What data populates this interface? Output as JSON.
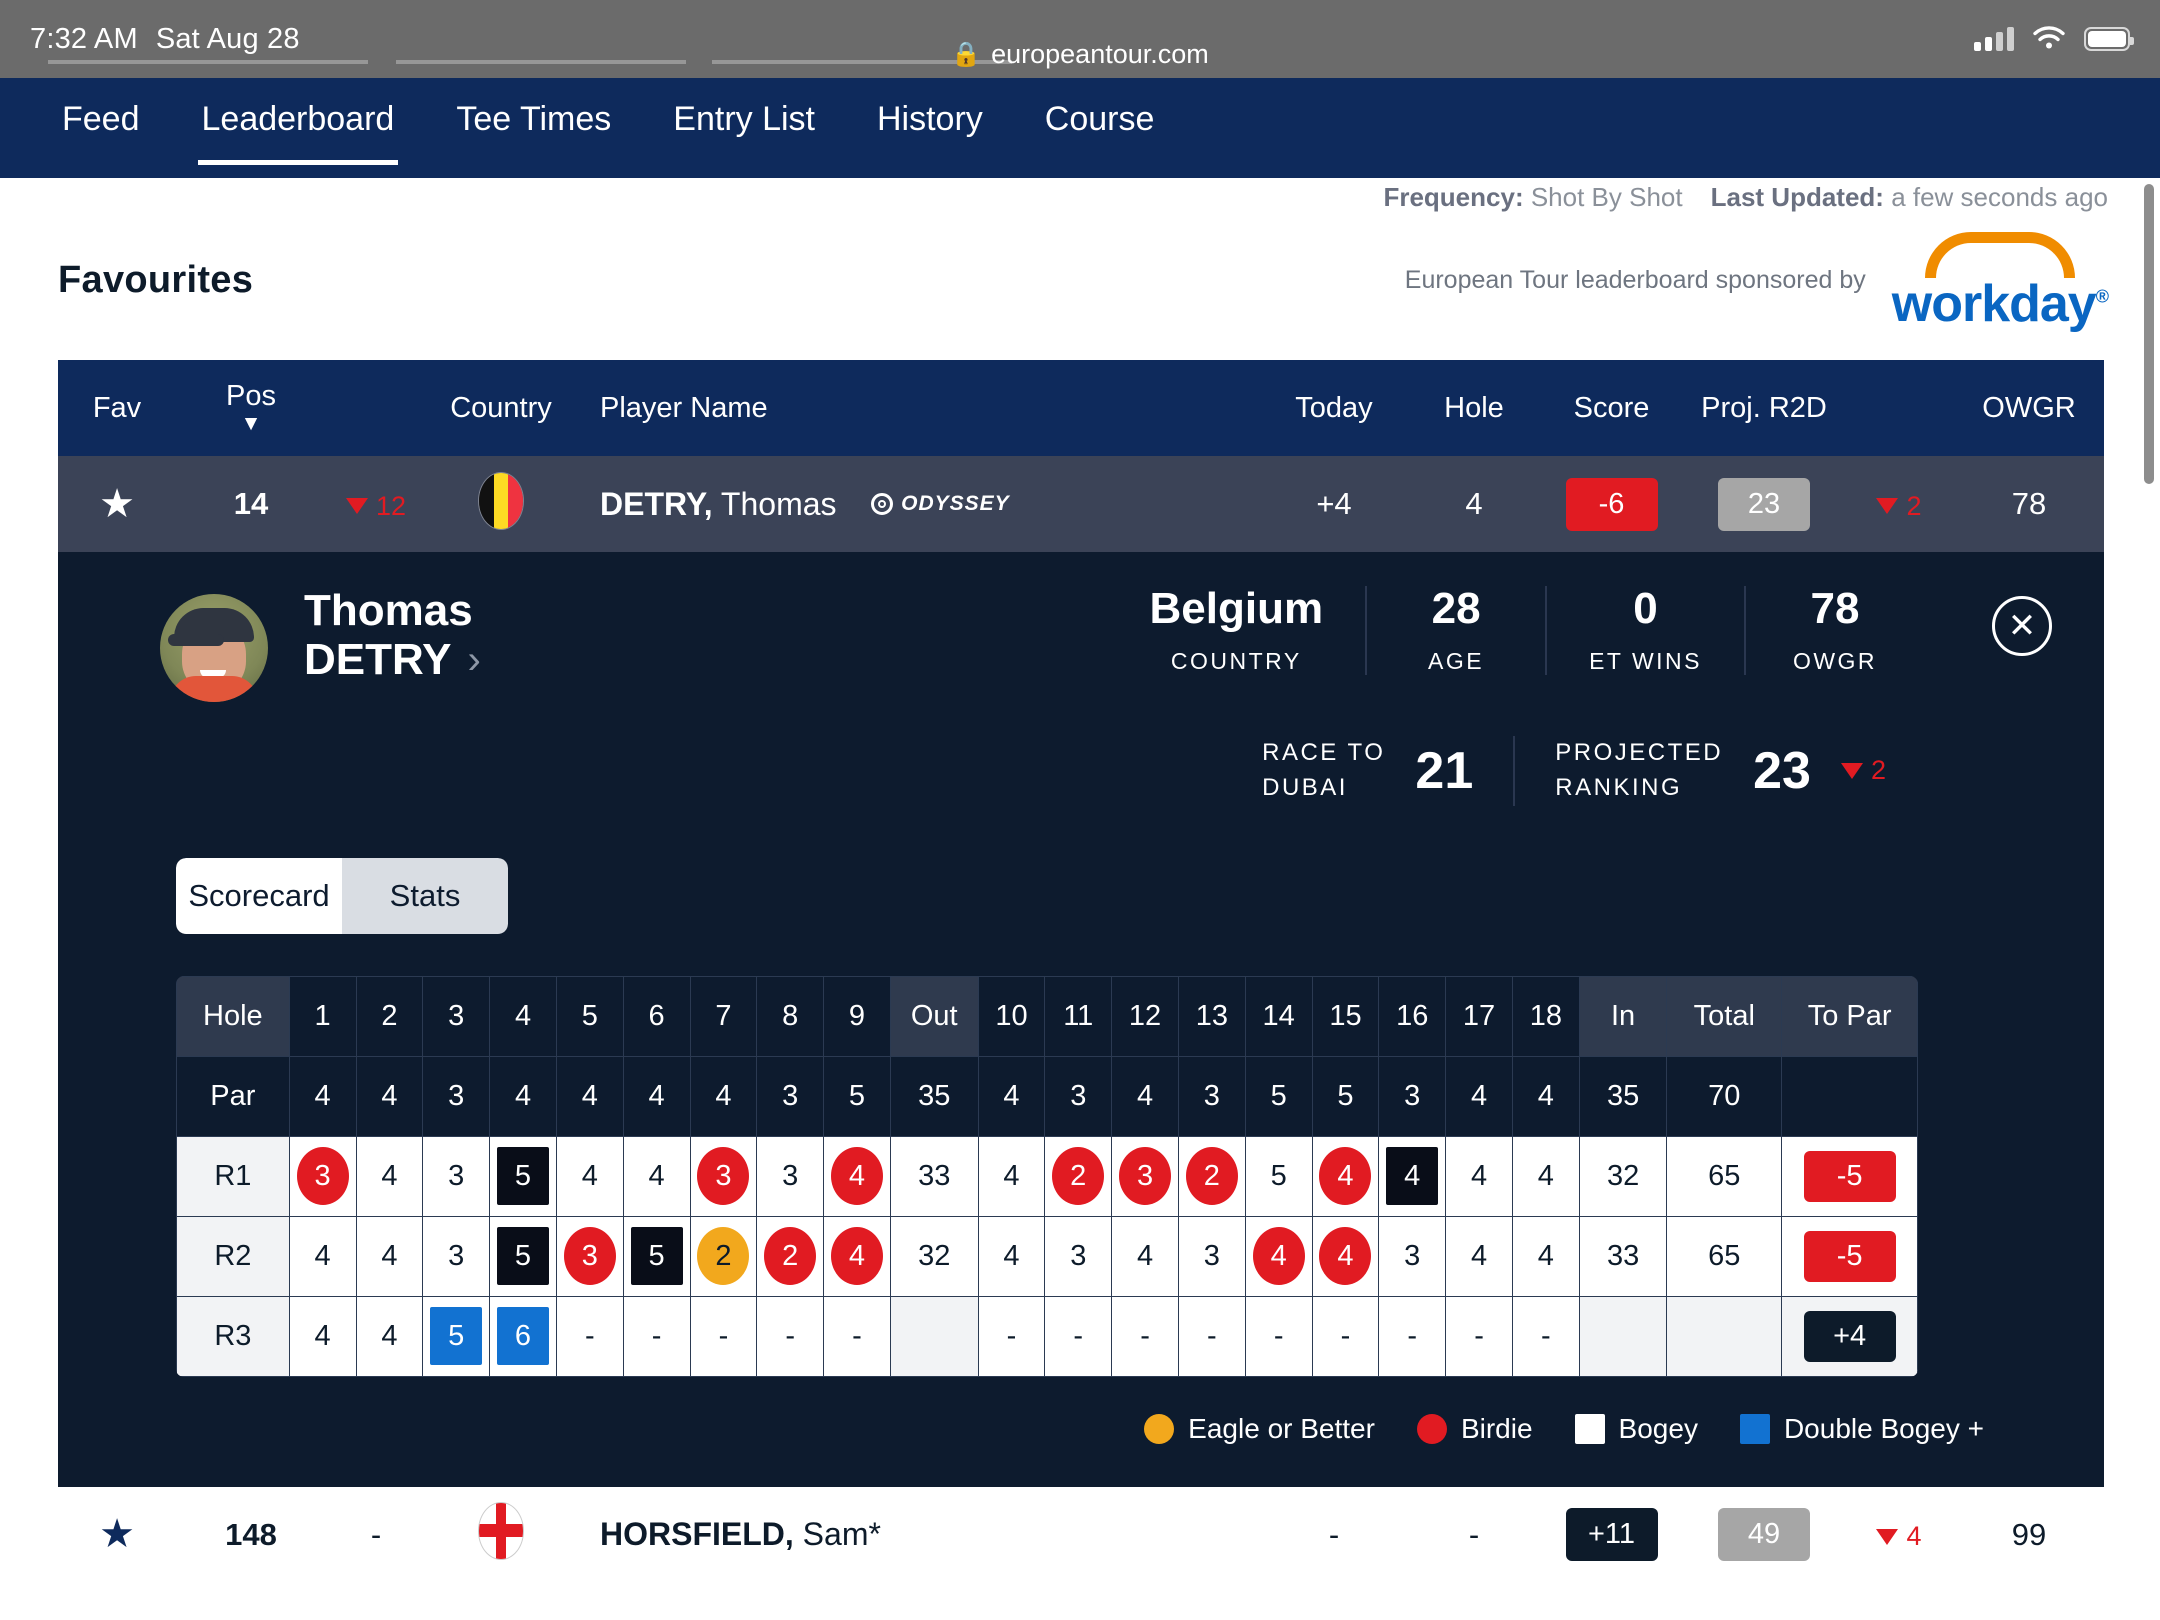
{
  "status_bar": {
    "time": "7:32 AM",
    "date": "Sat Aug 28"
  },
  "browser": {
    "url": "europeantour.com",
    "lock_icon": "lock-icon"
  },
  "nav": {
    "items": [
      {
        "label": "Feed",
        "active": false
      },
      {
        "label": "Leaderboard",
        "active": true
      },
      {
        "label": "Tee Times",
        "active": false
      },
      {
        "label": "Entry List",
        "active": false
      },
      {
        "label": "History",
        "active": false
      },
      {
        "label": "Course",
        "active": false
      }
    ]
  },
  "meta": {
    "frequency_label": "Frequency:",
    "frequency_value": "Shot By Shot",
    "updated_label": "Last Updated:",
    "updated_value": "a few seconds ago"
  },
  "section": {
    "title": "Favourites",
    "sponsor_text": "European Tour leaderboard sponsored by",
    "sponsor_name": "workday"
  },
  "table": {
    "headers": {
      "fav": "Fav",
      "pos": "Pos",
      "country": "Country",
      "player": "Player Name",
      "today": "Today",
      "hole": "Hole",
      "score": "Score",
      "proj": "Proj. R2D",
      "owgr": "OWGR"
    },
    "rows": [
      {
        "fav_icon": "star-filled-icon",
        "pos": "14",
        "move_dir": "down",
        "move_val": "12",
        "country_flag": "flag-belgium",
        "player_last": "DETRY,",
        "player_first": "Thomas",
        "sponsor_badge": "ODYSSEY",
        "today": "+4",
        "hole": "4",
        "score": "-6",
        "score_style": "red",
        "proj_r2d": "23",
        "proj_move_dir": "down",
        "proj_move_val": "2",
        "owgr": "78",
        "expanded": true
      },
      {
        "fav_icon": "star-filled-icon",
        "pos": "148",
        "move_dir": "none",
        "move_val": "-",
        "country_flag": "flag-england",
        "player_last": "HORSFIELD,",
        "player_first": "Sam*",
        "today": "-",
        "hole": "-",
        "score": "+11",
        "score_style": "navy",
        "proj_r2d": "49",
        "proj_move_dir": "down",
        "proj_move_val": "4",
        "owgr": "99",
        "expanded": false
      }
    ]
  },
  "detail": {
    "first_name": "Thomas",
    "last_name": "DETRY",
    "chevron": "›",
    "close_icon": "close-circle-icon",
    "stats": [
      {
        "value": "Belgium",
        "key": "COUNTRY"
      },
      {
        "value": "28",
        "key": "AGE"
      },
      {
        "value": "0",
        "key": "ET WINS"
      },
      {
        "value": "78",
        "key": "OWGR"
      }
    ],
    "rankings": [
      {
        "key_line1": "RACE TO",
        "key_line2": "DUBAI",
        "value": "21",
        "move_dir": "none",
        "move_val": ""
      },
      {
        "key_line1": "PROJECTED",
        "key_line2": "RANKING",
        "value": "23",
        "move_dir": "down",
        "move_val": "2"
      }
    ],
    "tabs": {
      "scorecard": "Scorecard",
      "stats": "Stats",
      "active": "Scorecard"
    }
  },
  "scorecard": {
    "row_labels": {
      "hole": "Hole",
      "par": "Par",
      "out": "Out",
      "in": "In",
      "total": "Total",
      "to_par": "To Par"
    },
    "holes": [
      "1",
      "2",
      "3",
      "4",
      "5",
      "6",
      "7",
      "8",
      "9"
    ],
    "holes_back": [
      "10",
      "11",
      "12",
      "13",
      "14",
      "15",
      "16",
      "17",
      "18"
    ],
    "par_front": [
      "4",
      "4",
      "3",
      "4",
      "4",
      "4",
      "4",
      "3",
      "5"
    ],
    "par_out": "35",
    "par_back": [
      "4",
      "3",
      "4",
      "3",
      "5",
      "5",
      "3",
      "4",
      "4"
    ],
    "par_in": "35",
    "par_total": "70",
    "rounds": [
      {
        "label": "R1",
        "front": [
          {
            "v": "3",
            "m": "birdie"
          },
          {
            "v": "4",
            "m": ""
          },
          {
            "v": "3",
            "m": ""
          },
          {
            "v": "5",
            "m": "bogey"
          },
          {
            "v": "4",
            "m": ""
          },
          {
            "v": "4",
            "m": ""
          },
          {
            "v": "3",
            "m": "birdie"
          },
          {
            "v": "3",
            "m": ""
          },
          {
            "v": "4",
            "m": "birdie"
          }
        ],
        "out": "33",
        "back": [
          {
            "v": "4",
            "m": ""
          },
          {
            "v": "2",
            "m": "birdie"
          },
          {
            "v": "3",
            "m": "birdie"
          },
          {
            "v": "2",
            "m": "birdie"
          },
          {
            "v": "5",
            "m": ""
          },
          {
            "v": "4",
            "m": "birdie"
          },
          {
            "v": "4",
            "m": "bogey"
          },
          {
            "v": "4",
            "m": ""
          },
          {
            "v": "4",
            "m": ""
          }
        ],
        "in": "32",
        "total": "65",
        "to_par": "-5",
        "to_par_style": "red"
      },
      {
        "label": "R2",
        "front": [
          {
            "v": "4",
            "m": ""
          },
          {
            "v": "4",
            "m": ""
          },
          {
            "v": "3",
            "m": ""
          },
          {
            "v": "5",
            "m": "bogey"
          },
          {
            "v": "3",
            "m": "birdie"
          },
          {
            "v": "5",
            "m": "bogey"
          },
          {
            "v": "2",
            "m": "eagle"
          },
          {
            "v": "2",
            "m": "birdie"
          },
          {
            "v": "4",
            "m": "birdie"
          }
        ],
        "out": "32",
        "back": [
          {
            "v": "4",
            "m": ""
          },
          {
            "v": "3",
            "m": ""
          },
          {
            "v": "4",
            "m": ""
          },
          {
            "v": "3",
            "m": ""
          },
          {
            "v": "4",
            "m": "birdie"
          },
          {
            "v": "4",
            "m": "birdie"
          },
          {
            "v": "3",
            "m": ""
          },
          {
            "v": "4",
            "m": ""
          },
          {
            "v": "4",
            "m": ""
          }
        ],
        "in": "33",
        "total": "65",
        "to_par": "-5",
        "to_par_style": "red"
      },
      {
        "label": "R3",
        "front": [
          {
            "v": "4",
            "m": ""
          },
          {
            "v": "4",
            "m": ""
          },
          {
            "v": "5",
            "m": "dbl"
          },
          {
            "v": "6",
            "m": "dbl"
          },
          {
            "v": "-",
            "m": ""
          },
          {
            "v": "-",
            "m": ""
          },
          {
            "v": "-",
            "m": ""
          },
          {
            "v": "-",
            "m": ""
          },
          {
            "v": "-",
            "m": ""
          }
        ],
        "out": "",
        "back": [
          {
            "v": "-",
            "m": ""
          },
          {
            "v": "-",
            "m": ""
          },
          {
            "v": "-",
            "m": ""
          },
          {
            "v": "-",
            "m": ""
          },
          {
            "v": "-",
            "m": ""
          },
          {
            "v": "-",
            "m": ""
          },
          {
            "v": "-",
            "m": ""
          },
          {
            "v": "-",
            "m": ""
          },
          {
            "v": "-",
            "m": ""
          }
        ],
        "in": "",
        "total": "",
        "to_par": "+4",
        "to_par_style": "navy"
      }
    ],
    "legend": [
      {
        "label": "Eagle or Better",
        "swatch": "c-eagle"
      },
      {
        "label": "Birdie",
        "swatch": "c-birdie"
      },
      {
        "label": "Bogey",
        "swatch": "c-bogey"
      },
      {
        "label": "Double Bogey +",
        "swatch": "c-dbl"
      }
    ]
  },
  "colors": {
    "nav_navy": "#0e2a5c",
    "panel_navy": "#0d1b2e",
    "row_slate": "#3b4357",
    "red": "#e11b22",
    "amber": "#f2a81d",
    "blue": "#1272d1",
    "sponsor_orange": "#f08c00",
    "sponsor_blue": "#0a66c2"
  }
}
